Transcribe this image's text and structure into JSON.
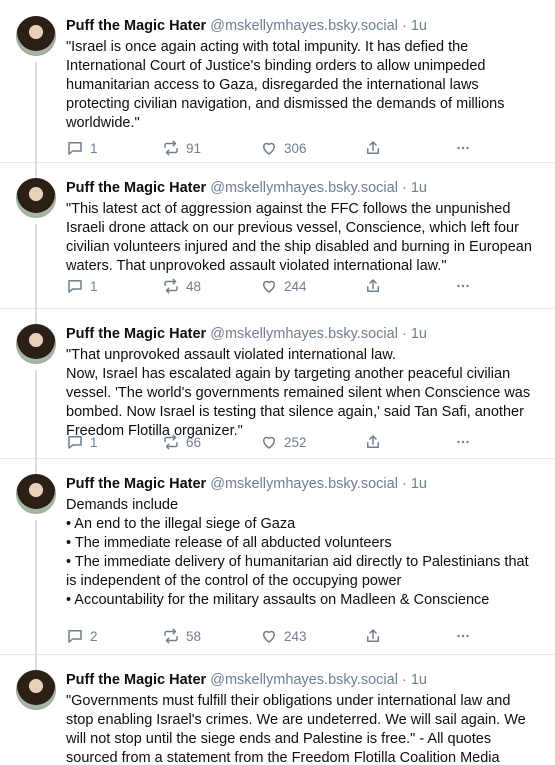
{
  "posts": [
    {
      "author": "Puff the Magic Hater",
      "handle": "@mskellymhayes.bsky.social",
      "time": "1u",
      "text": "\"Israel is once again acting with total impunity. It has defied the International Court of Justice's binding orders to allow unimpeded humanitarian access to Gaza, disregarded the international laws protecting civilian navigation, and dismissed the demands of millions worldwide.\"",
      "replies": "1",
      "reposts": "91",
      "likes": "306"
    },
    {
      "author": "Puff the Magic Hater",
      "handle": "@mskellymhayes.bsky.social",
      "time": "1u",
      "text": "\"This latest act of aggression against the FFC follows the unpunished Israeli drone attack on our previous vessel, Conscience, which left four civilian volunteers injured and the ship disabled and burning in European waters. That unprovoked assault violated international law.\"",
      "replies": "1",
      "reposts": "48",
      "likes": "244"
    },
    {
      "author": "Puff the Magic Hater",
      "handle": "@mskellymhayes.bsky.social",
      "time": "1u",
      "text": "\"That unprovoked assault violated international law.\nNow, Israel has escalated again by targeting another peaceful civilian vessel. 'The world's governments remained silent when Conscience was bombed. Now Israel is testing that silence again,' said Tan Safi, another Freedom Flotilla organizer.\"",
      "replies": "1",
      "reposts": "66",
      "likes": "252"
    },
    {
      "author": "Puff the Magic Hater",
      "handle": "@mskellymhayes.bsky.social",
      "time": "1u",
      "text": "Demands include\n• An end to the illegal siege of Gaza\n• The immediate release of all abducted volunteers\n•  The immediate delivery of humanitarian aid directly to Palestinians that is independent of the control of the occupying power\n• Accountability for the military assaults on Madleen & Conscience",
      "replies": "2",
      "reposts": "58",
      "likes": "243"
    },
    {
      "author": "Puff the Magic Hater",
      "handle": "@mskellymhayes.bsky.social",
      "time": "1u",
      "text": "\"Governments must fulfill their obligations under international law and stop enabling Israel's crimes. We are undeterred. We will sail again. We will not stop until the siege ends and Palestine is free.\" - All quotes sourced from a statement from the Freedom Flotilla Coalition Media",
      "replies": "",
      "reposts": "",
      "likes": ""
    }
  ]
}
